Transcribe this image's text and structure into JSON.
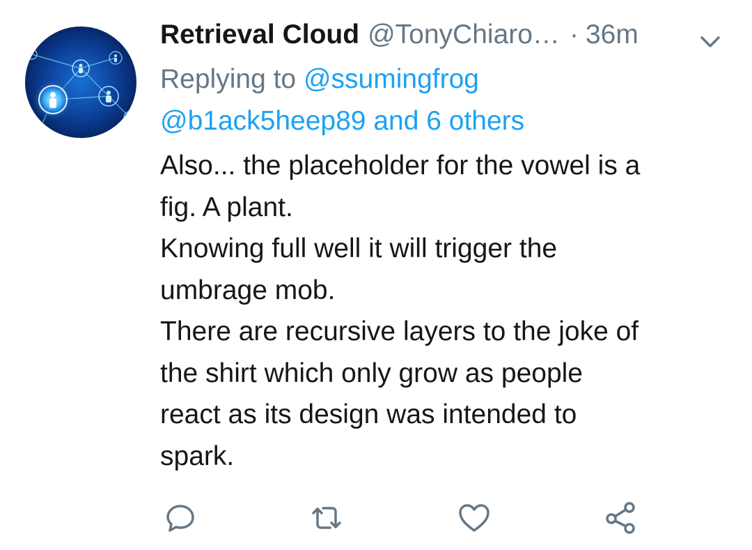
{
  "tweet": {
    "display_name": "Retrieval Cloud",
    "handle": "@TonyChiaro…",
    "separator": "·",
    "time": "36m",
    "replying_prefix": "Replying to",
    "replying_to_primary": "@ssumingfrog",
    "replying_to_rest": "@b1ack5heep89 and 6 others",
    "body_lines": [
      "Also... the placeholder for the vowel is a",
      "fig. A plant.",
      "Knowing full well it will trigger the",
      "umbrage mob.",
      "There are recursive layers to the joke of",
      "the shirt which only grow as people",
      "react as its design was intended to",
      "spark."
    ]
  },
  "icons": {
    "avatar": "network-people-avatar",
    "menu": "chevron-down-icon",
    "reply": "reply-icon",
    "retweet": "retweet-icon",
    "like": "heart-icon",
    "share": "share-icon"
  },
  "colors": {
    "name": "#14171a",
    "secondary": "#657786",
    "link": "#1da1f2",
    "icon": "#657786",
    "avatar_bg": "#0a2a6e",
    "avatar_glow": "#3fb7ff"
  }
}
